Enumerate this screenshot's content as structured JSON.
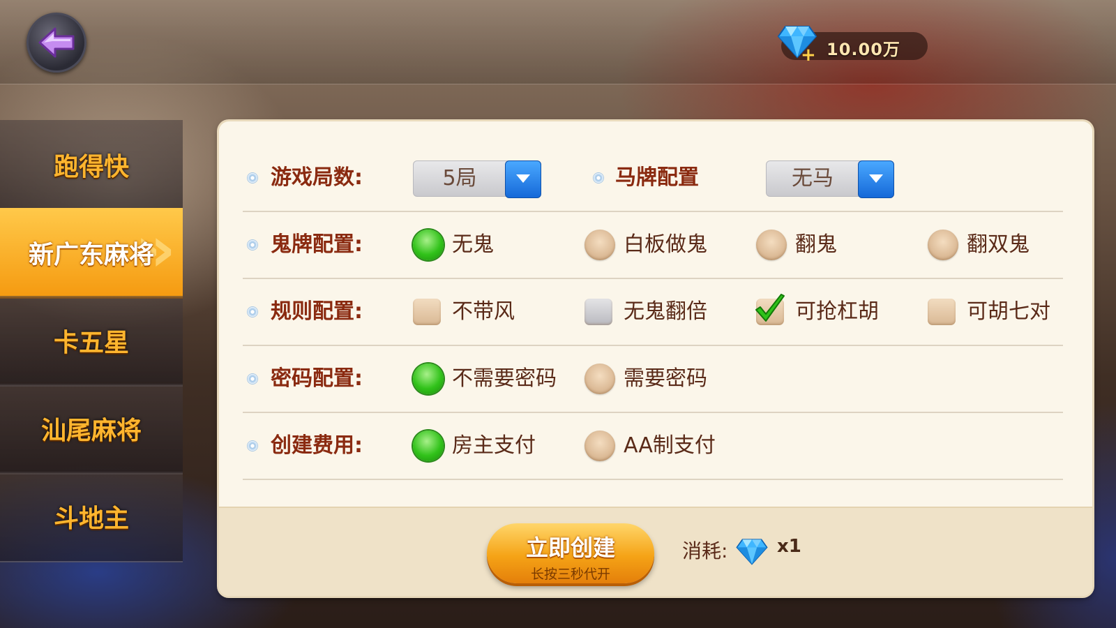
{
  "header": {
    "back_icon": "back-arrow-icon",
    "currency": {
      "icon": "diamond-icon",
      "plus": "+",
      "amount": "10.00万"
    }
  },
  "sidebar": {
    "items": [
      {
        "label": "跑得快",
        "active": false
      },
      {
        "label": "新广东麻将",
        "active": true
      },
      {
        "label": "卡五星",
        "active": false
      },
      {
        "label": "汕尾麻将",
        "active": false
      },
      {
        "label": "斗地主",
        "active": false
      }
    ]
  },
  "settings": {
    "rounds": {
      "label": "游戏局数:",
      "value": "5局"
    },
    "horse": {
      "label": "马牌配置",
      "value": "无马"
    },
    "ghost": {
      "label": "鬼牌配置:",
      "options": [
        {
          "text": "无鬼",
          "selected": true
        },
        {
          "text": "白板做鬼",
          "selected": false
        },
        {
          "text": "翻鬼",
          "selected": false
        },
        {
          "text": "翻双鬼",
          "selected": false
        }
      ]
    },
    "rules": {
      "label": "规则配置:",
      "options": [
        {
          "text": "不带风",
          "checked": false,
          "disabled": false
        },
        {
          "text": "无鬼翻倍",
          "checked": false,
          "disabled": true
        },
        {
          "text": "可抢杠胡",
          "checked": true,
          "disabled": false
        },
        {
          "text": "可胡七对",
          "checked": false,
          "disabled": false
        }
      ]
    },
    "password": {
      "label": "密码配置:",
      "options": [
        {
          "text": "不需要密码",
          "selected": true
        },
        {
          "text": "需要密码",
          "selected": false
        }
      ]
    },
    "fee": {
      "label": "创建费用:",
      "options": [
        {
          "text": "房主支付",
          "selected": true
        },
        {
          "text": "AA制支付",
          "selected": false
        }
      ]
    }
  },
  "footer": {
    "create_button": {
      "label": "立即创建",
      "sublabel": "长按三秒代开"
    },
    "cost": {
      "label": "消耗:",
      "icon": "diamond-icon",
      "qty": "x1"
    }
  },
  "colors": {
    "accent_orange": "#f5a316",
    "label_red": "#8a2a10",
    "radio_green": "#31c21a",
    "dropdown_blue": "#1569d8",
    "panel_bg": "#fbf6ea"
  }
}
